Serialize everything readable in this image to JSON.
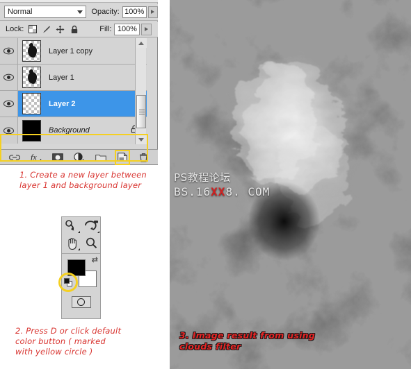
{
  "layers_panel": {
    "blend_mode": "Normal",
    "opacity_label": "Opacity:",
    "opacity_value": "100%",
    "lock_label": "Lock:",
    "fill_label": "Fill:",
    "fill_value": "100%",
    "lock_icons": [
      "transparency-lock-icon",
      "brush-lock-icon",
      "move-lock-icon",
      "lock-all-icon"
    ],
    "layers": [
      {
        "name": "Layer 1 copy",
        "visible": true,
        "selected": false,
        "thumb": "blob",
        "locked": false,
        "italic": false
      },
      {
        "name": "Layer 1",
        "visible": true,
        "selected": false,
        "thumb": "blob",
        "locked": false,
        "italic": false
      },
      {
        "name": "Layer 2",
        "visible": true,
        "selected": true,
        "thumb": "empty",
        "locked": false,
        "italic": false
      },
      {
        "name": "Background",
        "visible": true,
        "selected": false,
        "thumb": "black",
        "locked": true,
        "italic": true
      }
    ],
    "toolbar_icons": [
      {
        "name": "link-layers-icon",
        "highlighted": false
      },
      {
        "name": "layer-style-fx-icon",
        "highlighted": false
      },
      {
        "name": "layer-mask-icon",
        "highlighted": false
      },
      {
        "name": "adjustment-layer-icon",
        "highlighted": false
      },
      {
        "name": "new-group-folder-icon",
        "highlighted": false
      },
      {
        "name": "new-layer-icon",
        "highlighted": true
      },
      {
        "name": "delete-layer-trash-icon",
        "highlighted": false
      }
    ],
    "highlight_color": "#f5d020",
    "selected_row_color": "#3d95e8"
  },
  "tool_palette": {
    "tools": [
      "dodge-tool-icon",
      "blur-smudge-tool-icon",
      "hand-tool-icon",
      "zoom-tool-icon"
    ],
    "foreground_color": "#000000",
    "background_color": "#ffffff",
    "swap_colors_icon": "swap-colors-arrow-icon",
    "default_colors_icon": "default-colors-icon",
    "quick_mask_icon": "quick-mask-mode-icon",
    "highlight_color": "#f5d020"
  },
  "annotations": {
    "note1_line1": "1. Create a new layer between",
    "note1_line2": "layer 1 and background layer",
    "note2_line1": "2. Press D or click default",
    "note2_line2": "color button ( marked",
    "note2_line3": "with yellow circle )",
    "note3_line1": "3. Image result from using",
    "note3_line2": "clouds filter",
    "note_color": "#d8322e",
    "note3_color": "#e52525"
  },
  "watermark": {
    "cn_text": "PS教程论坛",
    "url_prefix": "BS.16",
    "url_red": "XX",
    "url_suffix": "8. COM",
    "red_color": "#d32020"
  }
}
